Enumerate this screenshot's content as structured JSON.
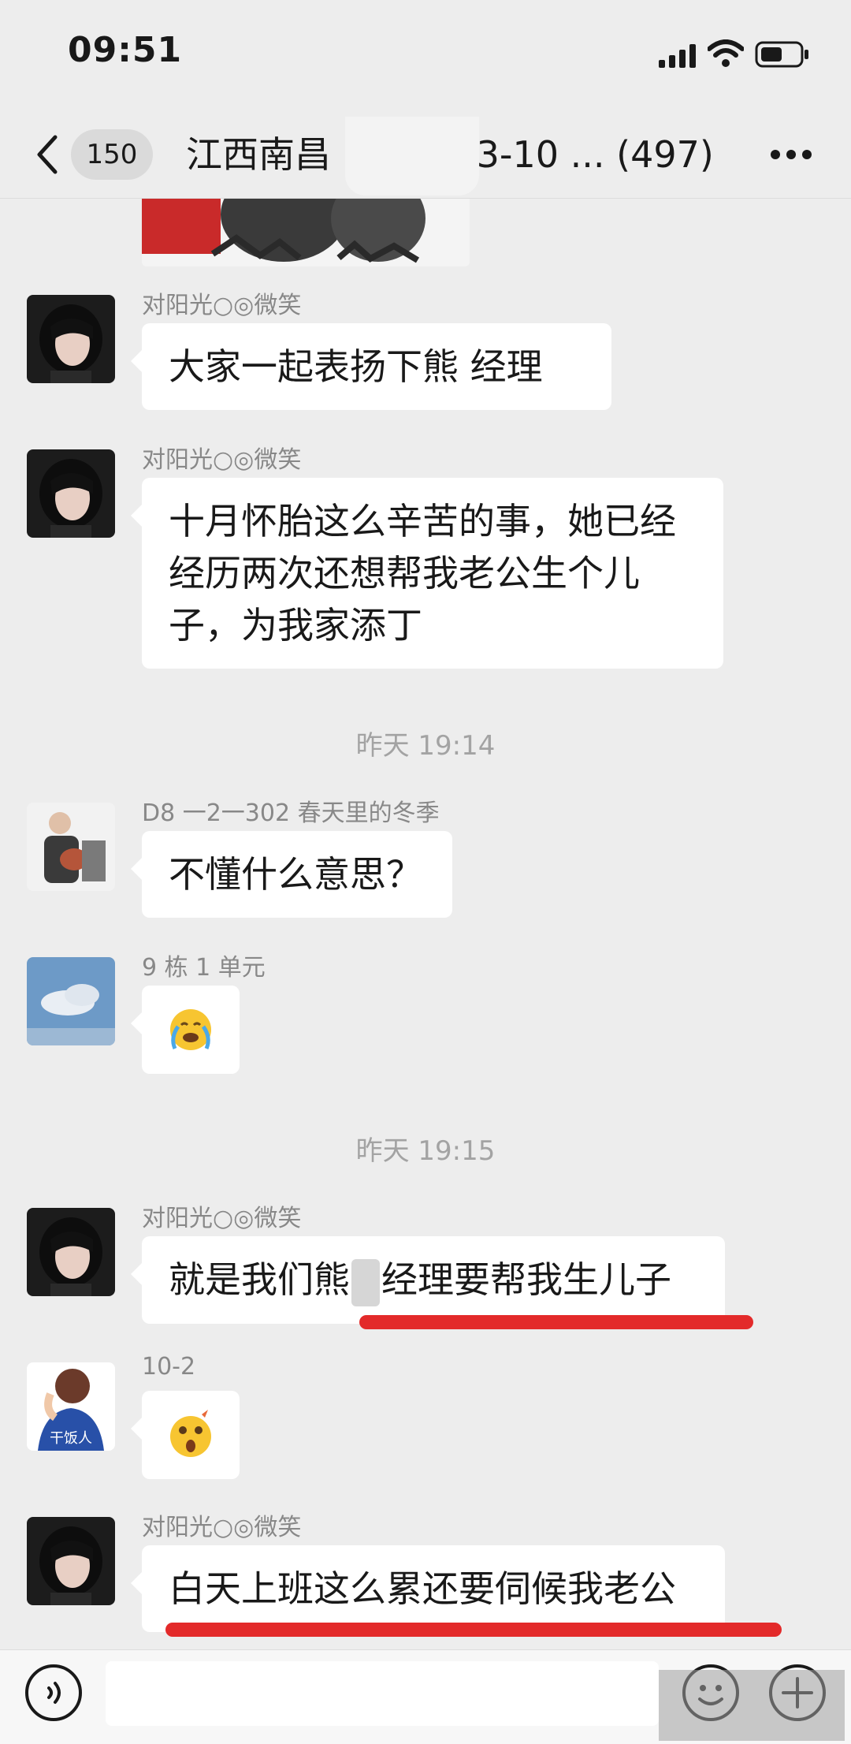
{
  "status_bar": {
    "time": "09:51",
    "icons": [
      "signal-icon",
      "wifi-icon",
      "battery-icon"
    ]
  },
  "nav": {
    "back_icon": "chevron-left-icon",
    "unread_count": "150",
    "title": "江西南昌 ",
    "title_suffix": "3-10 ... (497)",
    "more_icon": "more-dots-icon"
  },
  "messages": [
    {
      "sender": "对阳光○◎微笑",
      "text": "大家一起表扬下熊   经理",
      "avatar": "girl-avatar"
    },
    {
      "sender": "对阳光○◎微笑",
      "lines": [
        "十月怀胎这么辛苦的事，她已经",
        "经历两次还想帮我老公生个儿",
        "子，为我家添丁"
      ],
      "avatar": "girl-avatar"
    },
    {
      "timestamp": "昨天 19:14"
    },
    {
      "sender": "D8 一2一302 春天里的冬季",
      "text": "不懂什么意思？",
      "avatar": "man-avatar"
    },
    {
      "sender": "9 栋 1 单元",
      "emoji": "crying-face-emoji",
      "avatar": "sky-avatar"
    },
    {
      "timestamp": "昨天 19:15"
    },
    {
      "sender": "对阳光○◎微笑",
      "text_before_mask": "就是我们熊",
      "text_after_mask": "经理要帮我生儿子",
      "avatar": "girl-avatar"
    },
    {
      "sender": "10-2",
      "emoji": "shocked-face-emoji",
      "avatar": "cartoon-avatar",
      "avatar_text": "干饭人"
    },
    {
      "sender": "对阳光○◎微笑",
      "text": "白天上班这么累还要伺候我老公",
      "avatar": "girl-avatar"
    }
  ],
  "input_bar": {
    "voice_icon": "voice-icon",
    "emoji_icon": "emoji-icon",
    "plus_icon": "plus-icon",
    "placeholder": ""
  },
  "colors": {
    "background": "#ededed",
    "bubble": "#ffffff",
    "highlight_underline": "#e32a2a",
    "meta_text": "#888888"
  }
}
